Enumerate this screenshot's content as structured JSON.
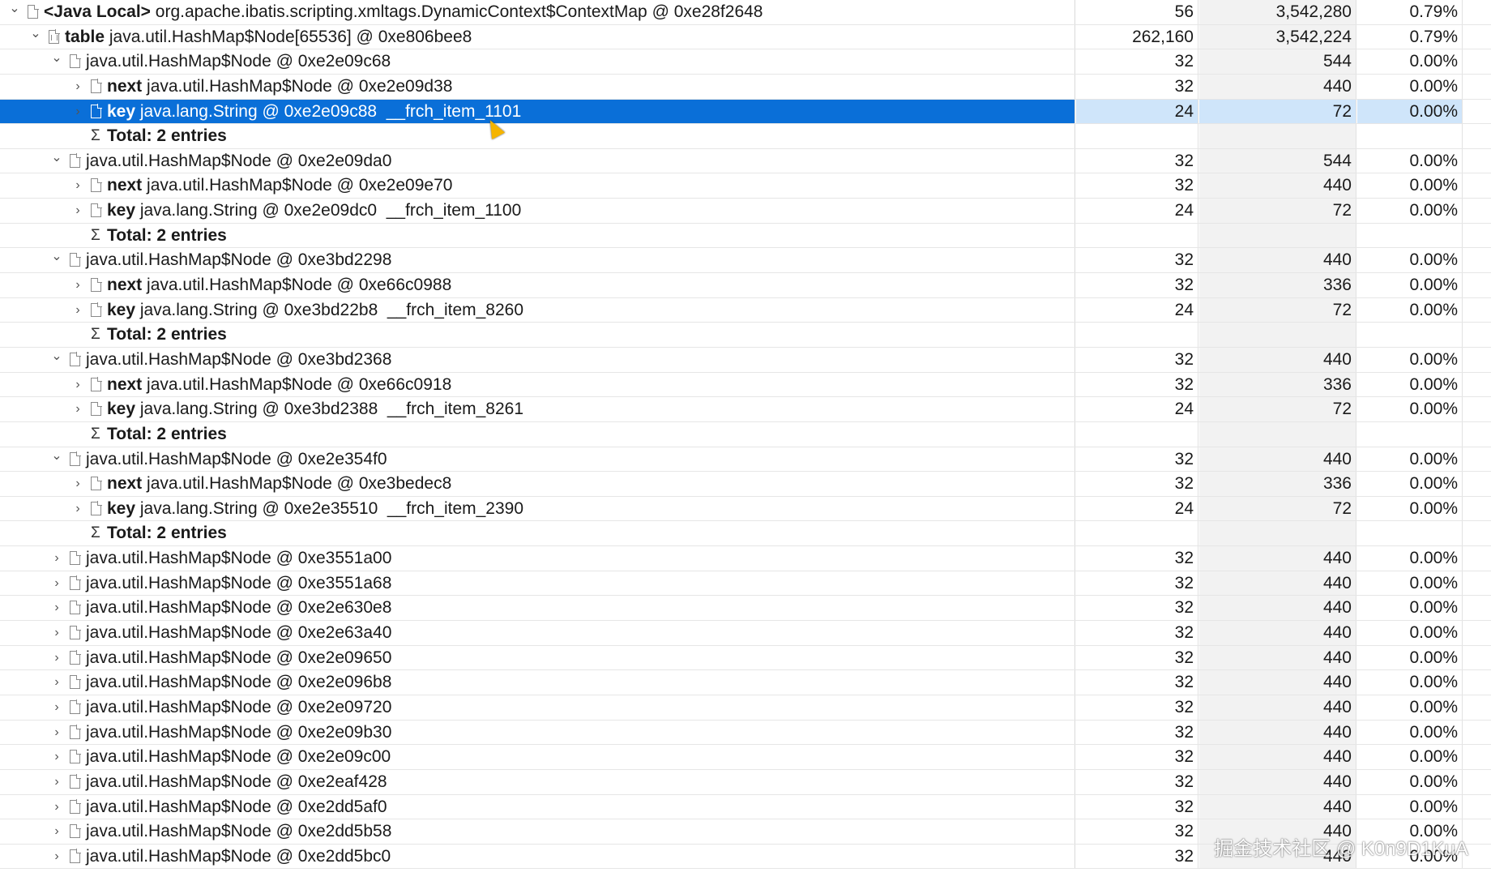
{
  "rows": [
    {
      "depth": 0,
      "toggle": "expanded",
      "icon": "doc",
      "bold": "<Java Local>",
      "text": "org.apache.ibatis.scripting.xmltags.DynamicContext$ContextMap @ 0xe28f2648",
      "shallow": "56",
      "retained": "3,542,280",
      "percent": "0.79%"
    },
    {
      "depth": 1,
      "toggle": "expanded",
      "icon": "array",
      "bold": "table",
      "text": "java.util.HashMap$Node[65536] @ 0xe806bee8",
      "shallow": "262,160",
      "retained": "3,542,224",
      "percent": "0.79%"
    },
    {
      "depth": 2,
      "toggle": "expanded",
      "icon": "doc",
      "bold": "",
      "text": "java.util.HashMap$Node @ 0xe2e09c68",
      "shallow": "32",
      "retained": "544",
      "percent": "0.00%"
    },
    {
      "depth": 3,
      "toggle": "collapsed",
      "icon": "doc",
      "bold": "next",
      "text": "java.util.HashMap$Node @ 0xe2e09d38",
      "shallow": "32",
      "retained": "440",
      "percent": "0.00%"
    },
    {
      "depth": 3,
      "toggle": "collapsed",
      "icon": "doc",
      "bold": "key",
      "text": "java.lang.String @ 0xe2e09c88  __frch_item_1101",
      "shallow": "24",
      "retained": "72",
      "percent": "0.00%",
      "selected": true
    },
    {
      "depth": 3,
      "toggle": "none",
      "icon": "sigma",
      "bold": "Total: 2 entries",
      "text": "",
      "shallow": "",
      "retained": "",
      "percent": ""
    },
    {
      "depth": 2,
      "toggle": "expanded",
      "icon": "doc",
      "bold": "",
      "text": "java.util.HashMap$Node @ 0xe2e09da0",
      "shallow": "32",
      "retained": "544",
      "percent": "0.00%"
    },
    {
      "depth": 3,
      "toggle": "collapsed",
      "icon": "doc",
      "bold": "next",
      "text": "java.util.HashMap$Node @ 0xe2e09e70",
      "shallow": "32",
      "retained": "440",
      "percent": "0.00%"
    },
    {
      "depth": 3,
      "toggle": "collapsed",
      "icon": "doc",
      "bold": "key",
      "text": "java.lang.String @ 0xe2e09dc0  __frch_item_1100",
      "shallow": "24",
      "retained": "72",
      "percent": "0.00%"
    },
    {
      "depth": 3,
      "toggle": "none",
      "icon": "sigma",
      "bold": "Total: 2 entries",
      "text": "",
      "shallow": "",
      "retained": "",
      "percent": ""
    },
    {
      "depth": 2,
      "toggle": "expanded",
      "icon": "doc",
      "bold": "",
      "text": "java.util.HashMap$Node @ 0xe3bd2298",
      "shallow": "32",
      "retained": "440",
      "percent": "0.00%"
    },
    {
      "depth": 3,
      "toggle": "collapsed",
      "icon": "doc",
      "bold": "next",
      "text": "java.util.HashMap$Node @ 0xe66c0988",
      "shallow": "32",
      "retained": "336",
      "percent": "0.00%"
    },
    {
      "depth": 3,
      "toggle": "collapsed",
      "icon": "doc",
      "bold": "key",
      "text": "java.lang.String @ 0xe3bd22b8  __frch_item_8260",
      "shallow": "24",
      "retained": "72",
      "percent": "0.00%"
    },
    {
      "depth": 3,
      "toggle": "none",
      "icon": "sigma",
      "bold": "Total: 2 entries",
      "text": "",
      "shallow": "",
      "retained": "",
      "percent": ""
    },
    {
      "depth": 2,
      "toggle": "expanded",
      "icon": "doc",
      "bold": "",
      "text": "java.util.HashMap$Node @ 0xe3bd2368",
      "shallow": "32",
      "retained": "440",
      "percent": "0.00%"
    },
    {
      "depth": 3,
      "toggle": "collapsed",
      "icon": "doc",
      "bold": "next",
      "text": "java.util.HashMap$Node @ 0xe66c0918",
      "shallow": "32",
      "retained": "336",
      "percent": "0.00%"
    },
    {
      "depth": 3,
      "toggle": "collapsed",
      "icon": "doc",
      "bold": "key",
      "text": "java.lang.String @ 0xe3bd2388  __frch_item_8261",
      "shallow": "24",
      "retained": "72",
      "percent": "0.00%"
    },
    {
      "depth": 3,
      "toggle": "none",
      "icon": "sigma",
      "bold": "Total: 2 entries",
      "text": "",
      "shallow": "",
      "retained": "",
      "percent": ""
    },
    {
      "depth": 2,
      "toggle": "expanded",
      "icon": "doc",
      "bold": "",
      "text": "java.util.HashMap$Node @ 0xe2e354f0",
      "shallow": "32",
      "retained": "440",
      "percent": "0.00%"
    },
    {
      "depth": 3,
      "toggle": "collapsed",
      "icon": "doc",
      "bold": "next",
      "text": "java.util.HashMap$Node @ 0xe3bedec8",
      "shallow": "32",
      "retained": "336",
      "percent": "0.00%"
    },
    {
      "depth": 3,
      "toggle": "collapsed",
      "icon": "doc",
      "bold": "key",
      "text": "java.lang.String @ 0xe2e35510  __frch_item_2390",
      "shallow": "24",
      "retained": "72",
      "percent": "0.00%"
    },
    {
      "depth": 3,
      "toggle": "none",
      "icon": "sigma",
      "bold": "Total: 2 entries",
      "text": "",
      "shallow": "",
      "retained": "",
      "percent": ""
    },
    {
      "depth": 2,
      "toggle": "collapsed",
      "icon": "doc",
      "bold": "",
      "text": "java.util.HashMap$Node @ 0xe3551a00",
      "shallow": "32",
      "retained": "440",
      "percent": "0.00%"
    },
    {
      "depth": 2,
      "toggle": "collapsed",
      "icon": "doc",
      "bold": "",
      "text": "java.util.HashMap$Node @ 0xe3551a68",
      "shallow": "32",
      "retained": "440",
      "percent": "0.00%"
    },
    {
      "depth": 2,
      "toggle": "collapsed",
      "icon": "doc",
      "bold": "",
      "text": "java.util.HashMap$Node @ 0xe2e630e8",
      "shallow": "32",
      "retained": "440",
      "percent": "0.00%"
    },
    {
      "depth": 2,
      "toggle": "collapsed",
      "icon": "doc",
      "bold": "",
      "text": "java.util.HashMap$Node @ 0xe2e63a40",
      "shallow": "32",
      "retained": "440",
      "percent": "0.00%"
    },
    {
      "depth": 2,
      "toggle": "collapsed",
      "icon": "doc",
      "bold": "",
      "text": "java.util.HashMap$Node @ 0xe2e09650",
      "shallow": "32",
      "retained": "440",
      "percent": "0.00%"
    },
    {
      "depth": 2,
      "toggle": "collapsed",
      "icon": "doc",
      "bold": "",
      "text": "java.util.HashMap$Node @ 0xe2e096b8",
      "shallow": "32",
      "retained": "440",
      "percent": "0.00%"
    },
    {
      "depth": 2,
      "toggle": "collapsed",
      "icon": "doc",
      "bold": "",
      "text": "java.util.HashMap$Node @ 0xe2e09720",
      "shallow": "32",
      "retained": "440",
      "percent": "0.00%"
    },
    {
      "depth": 2,
      "toggle": "collapsed",
      "icon": "doc",
      "bold": "",
      "text": "java.util.HashMap$Node @ 0xe2e09b30",
      "shallow": "32",
      "retained": "440",
      "percent": "0.00%"
    },
    {
      "depth": 2,
      "toggle": "collapsed",
      "icon": "doc",
      "bold": "",
      "text": "java.util.HashMap$Node @ 0xe2e09c00",
      "shallow": "32",
      "retained": "440",
      "percent": "0.00%"
    },
    {
      "depth": 2,
      "toggle": "collapsed",
      "icon": "doc",
      "bold": "",
      "text": "java.util.HashMap$Node @ 0xe2eaf428",
      "shallow": "32",
      "retained": "440",
      "percent": "0.00%"
    },
    {
      "depth": 2,
      "toggle": "collapsed",
      "icon": "doc",
      "bold": "",
      "text": "java.util.HashMap$Node @ 0xe2dd5af0",
      "shallow": "32",
      "retained": "440",
      "percent": "0.00%"
    },
    {
      "depth": 2,
      "toggle": "collapsed",
      "icon": "doc",
      "bold": "",
      "text": "java.util.HashMap$Node @ 0xe2dd5b58",
      "shallow": "32",
      "retained": "440",
      "percent": "0.00%"
    },
    {
      "depth": 2,
      "toggle": "collapsed",
      "icon": "doc",
      "bold": "",
      "text": "java.util.HashMap$Node @ 0xe2dd5bc0",
      "shallow": "32",
      "retained": "440",
      "percent": "0.00%"
    }
  ],
  "watermark": "掘金技术社区 @ K0n9D1KuA",
  "colors": {
    "selection": "#0a6fd8",
    "selection_values": "#cfe5fa"
  }
}
